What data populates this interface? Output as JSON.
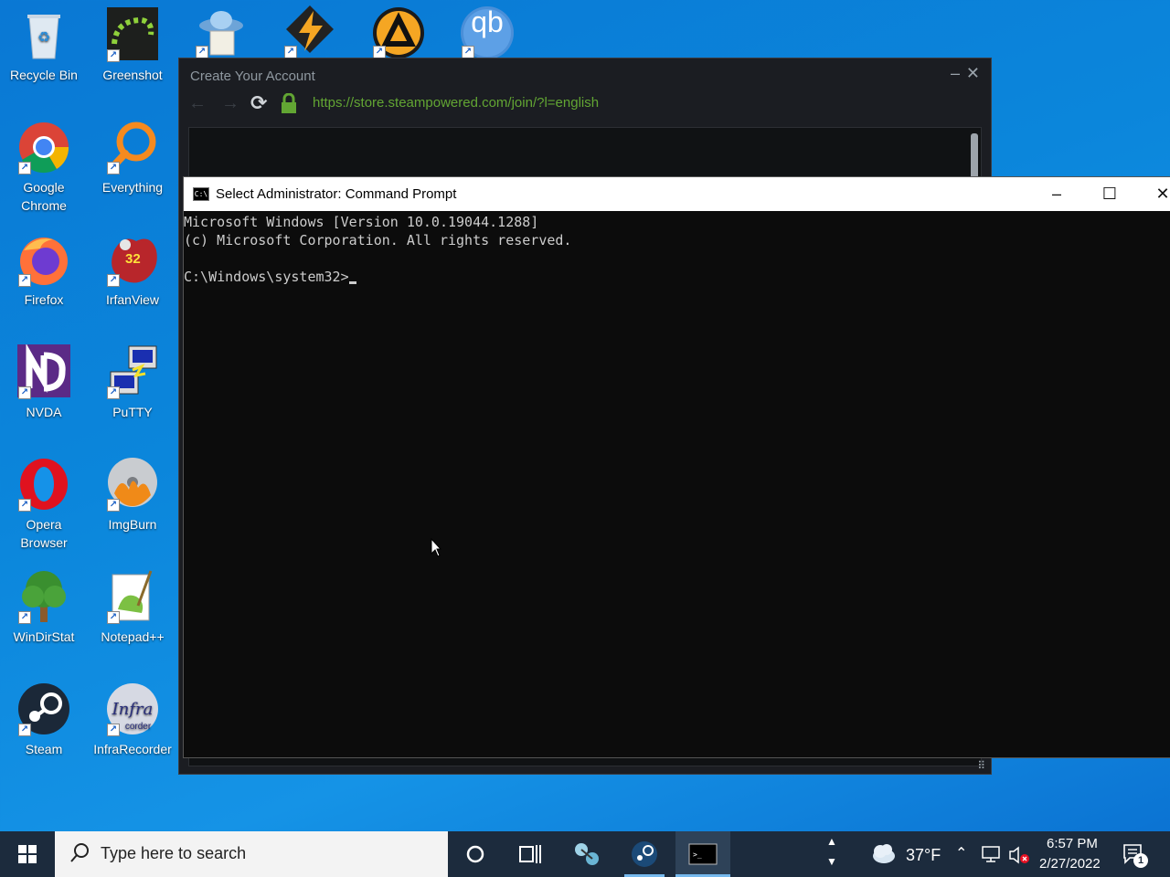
{
  "desktop": {
    "icons": [
      {
        "label": "Recycle Bin"
      },
      {
        "label": "Greenshot"
      },
      {
        "label": "Google Chrome"
      },
      {
        "label": "Everything"
      },
      {
        "label": "Firefox"
      },
      {
        "label": "IrfanView"
      },
      {
        "label": "NVDA"
      },
      {
        "label": "PuTTY"
      },
      {
        "label": "Opera Browser"
      },
      {
        "label": "ImgBurn"
      },
      {
        "label": "WinDirStat"
      },
      {
        "label": "Notepad++"
      },
      {
        "label": "Steam"
      },
      {
        "label": "InfraRecorder"
      },
      {
        "label": "qb"
      }
    ],
    "irfanview_badge": "32"
  },
  "steam_window": {
    "title": "Create Your Account",
    "url": "https://store.steampowered.com/join/?l=english"
  },
  "cmd_window": {
    "title": "Select Administrator: Command Prompt",
    "lines": [
      "Microsoft Windows [Version 10.0.19044.1288]",
      "(c) Microsoft Corporation. All rights reserved.",
      "",
      "C:\\Windows\\system32>"
    ]
  },
  "taskbar": {
    "search_placeholder": "Type here to search",
    "weather": "37°F",
    "time": "6:57 PM",
    "date": "2/27/2022",
    "notification_count": "1"
  }
}
